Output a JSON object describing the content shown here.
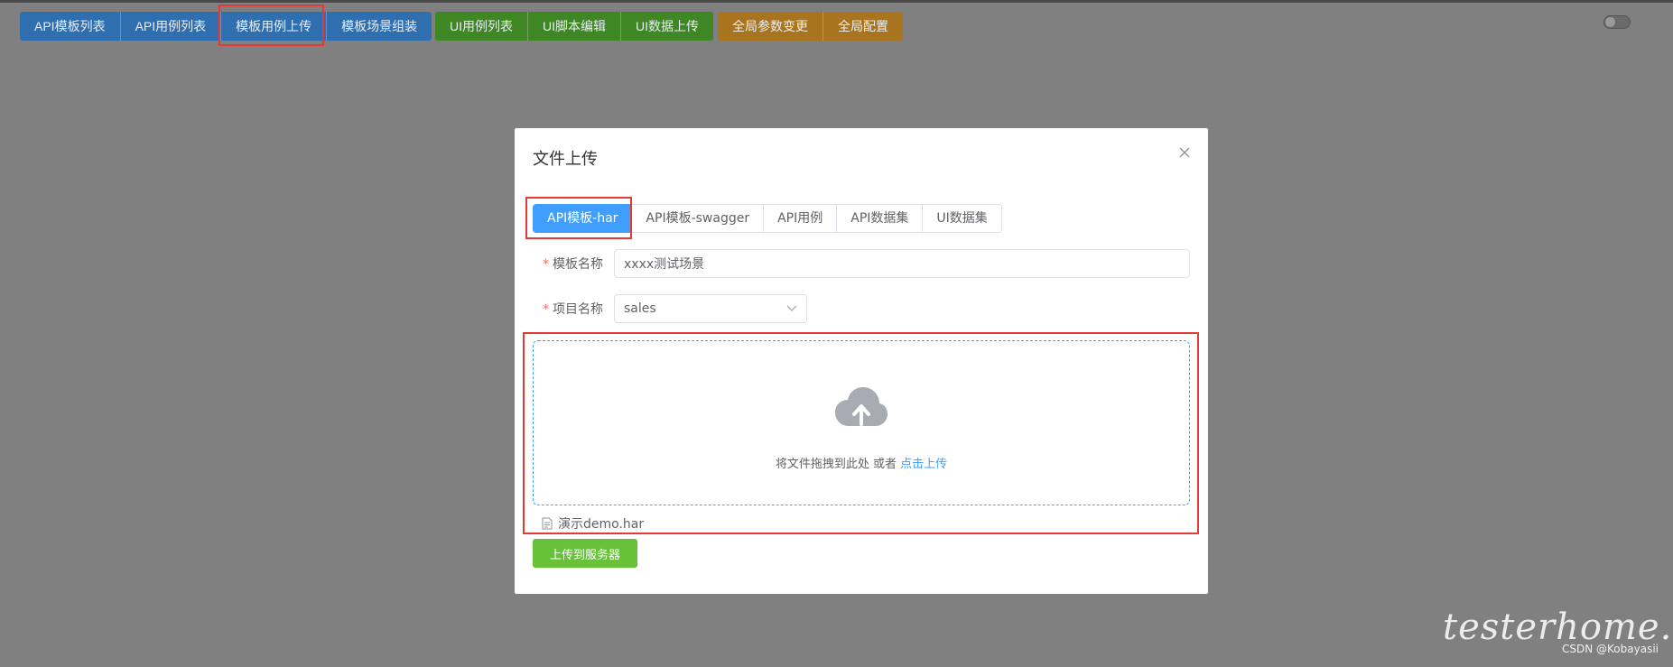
{
  "toolbar": {
    "blue": [
      "API模板列表",
      "API用例列表",
      "模板用例上传",
      "模板场景组装"
    ],
    "green": [
      "UI用例列表",
      "UI脚本编辑",
      "UI数据上传"
    ],
    "orange": [
      "全局参数变更",
      "全局配置"
    ]
  },
  "dialog": {
    "title": "文件上传",
    "tabs": [
      "API模板-har",
      "API模板-swagger",
      "API用例",
      "API数据集",
      "UI数据集"
    ],
    "active_tab": "API模板-har",
    "template_name": {
      "label": "模板名称",
      "required_mark": "*",
      "value": "xxxx测试场景"
    },
    "project_name": {
      "label": "项目名称",
      "required_mark": "*",
      "value": "sales"
    },
    "upload": {
      "hint": "将文件拖拽到此处 或者",
      "link": "点击上传",
      "icon": "cloud-upload-icon"
    },
    "file": {
      "name": "演示demo.har",
      "icon": "document-icon"
    },
    "submit_label": "上传到服务器"
  },
  "watermark": "testerhome.com",
  "credit": "CSDN @Kobayasii",
  "colors": {
    "primary": "#409eff",
    "success": "#67c23a",
    "annotation": "#e53935"
  }
}
